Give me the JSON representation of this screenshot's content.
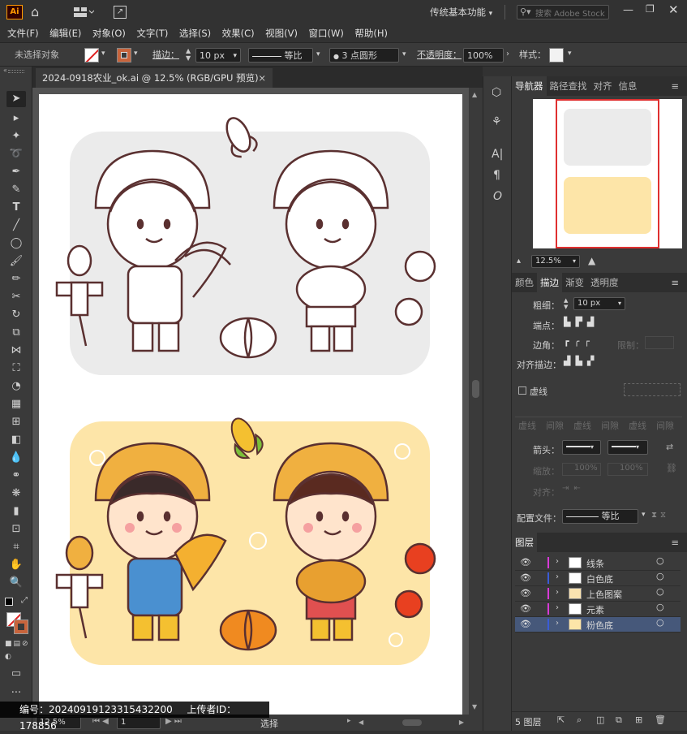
{
  "titlebar": {
    "app_icon": "Ai",
    "workspace": "传统基本功能",
    "search_placeholder": "搜索 Adobe Stock"
  },
  "menu": [
    "文件(F)",
    "编辑(E)",
    "对象(O)",
    "文字(T)",
    "选择(S)",
    "效果(C)",
    "视图(V)",
    "窗口(W)",
    "帮助(H)"
  ],
  "control": {
    "selection_status": "未选择对象",
    "stroke_label": "描边：",
    "stroke_value": "10 px",
    "profile_label": "等比",
    "brush_label": "3 点圆形",
    "opacity_label": "不透明度：",
    "opacity_value": "100%",
    "style_label": "样式："
  },
  "document": {
    "tab_title": "2024-0918农业_ok.ai @ 12.5% (RGB/GPU 预览)",
    "close": "×"
  },
  "status": {
    "zoom": "12.5%",
    "artboard": "1",
    "tool": "选择"
  },
  "watermark": {
    "id_label": "编号：",
    "id": "20240919123315432200",
    "uploader_label": "上传者ID：",
    "uploader": "178856"
  },
  "navigator": {
    "tabs": [
      "导航器",
      "路径查找",
      "对齐",
      "信息"
    ],
    "zoom": "12.5%"
  },
  "stroke_panel": {
    "tabs": [
      "颜色",
      "描边",
      "渐变",
      "透明度"
    ],
    "weight_label": "粗细：",
    "weight_value": "10 px",
    "cap_label": "端点：",
    "corner_label": "边角：",
    "limit_label": "限制：",
    "align_label": "对齐描边：",
    "dashed_label": "虚线",
    "dash_fields": [
      "虚线",
      "间隙",
      "虚线",
      "间隙",
      "虚线",
      "间隙"
    ],
    "arrow_label": "箭头：",
    "scale_label": "缩放：",
    "scale_value_1": "100%",
    "scale_value_2": "100%",
    "align2_label": "对齐：",
    "profile_label": "配置文件：",
    "profile_value": "等比"
  },
  "layers": {
    "tab": "图层",
    "items": [
      {
        "name": "线条",
        "color": "#d83ad8"
      },
      {
        "name": "白色底",
        "color": "#3a5cd8"
      },
      {
        "name": "上色图案",
        "color": "#d83ad8"
      },
      {
        "name": "元素",
        "color": "#d83ad8"
      },
      {
        "name": "粉色底",
        "color": "#3a5cd8"
      }
    ],
    "count": "5 图层"
  },
  "colors": {
    "bg_dark": "#323232",
    "panel": "#3a3a3a",
    "artboard": "#ffffff",
    "line_color": "#5a3030",
    "gray_bg": "#ebebeb",
    "yellow_bg": "#fde5a8",
    "hat": "#f0b040",
    "overall_blue": "#4a90d0",
    "overall_red": "#e05050",
    "pumpkin": "#f08a20",
    "tomato": "#e84020"
  }
}
